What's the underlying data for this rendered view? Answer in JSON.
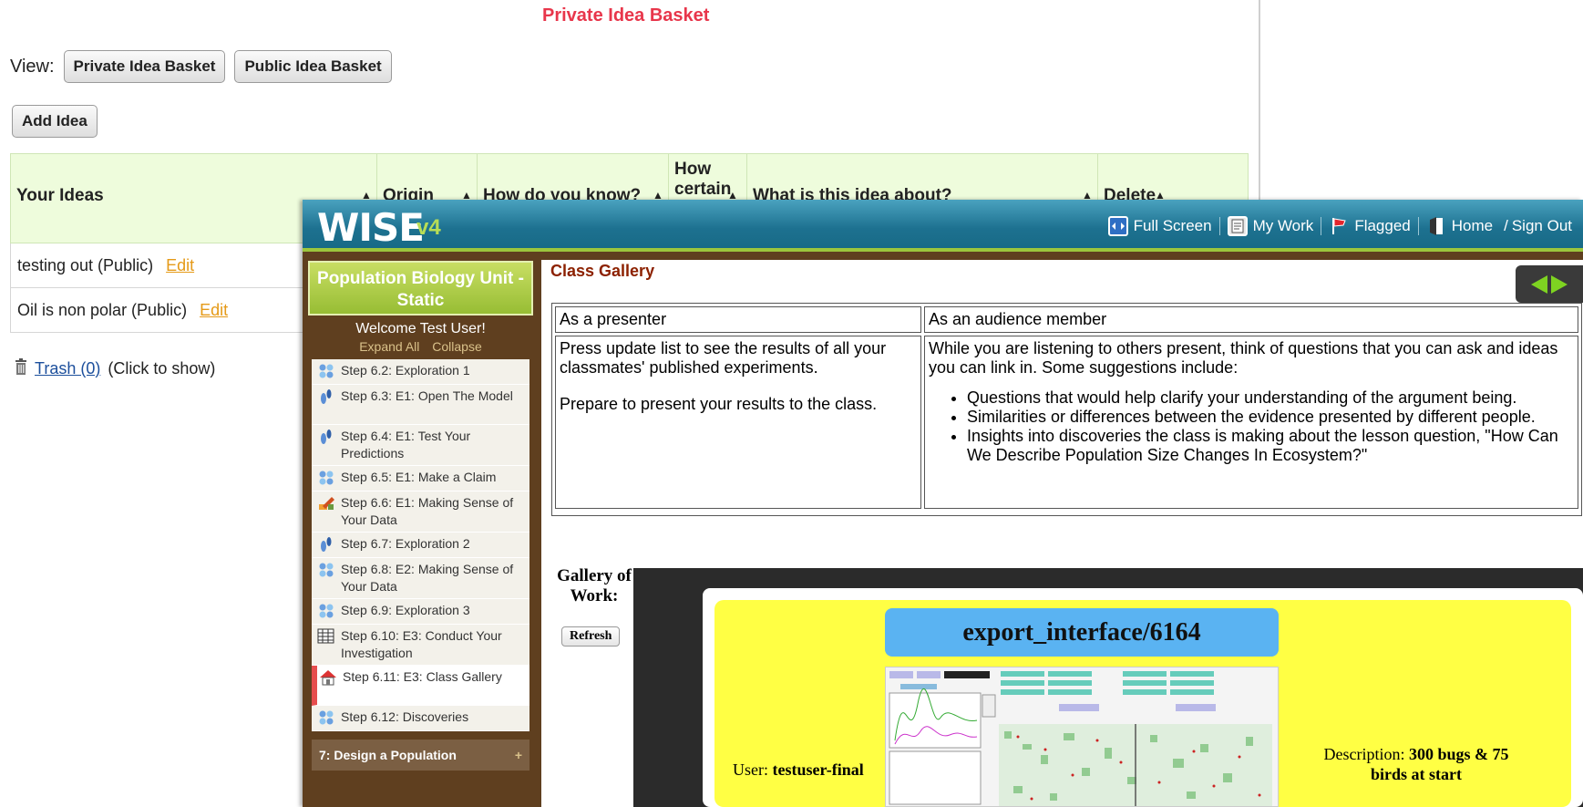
{
  "basket": {
    "title": "Private Idea Basket",
    "view_label": "View:",
    "view_private": "Private Idea Basket",
    "view_public": "Public Idea Basket",
    "add_idea": "Add Idea",
    "columns": [
      "Your Ideas",
      "Origin",
      "How do you know?",
      "How certain",
      "What is this idea about?",
      "Delete"
    ],
    "rows": [
      {
        "idea": "testing out (Public)",
        "edit": "Edit"
      },
      {
        "idea": "Oil is non polar (Public)",
        "edit": "Edit"
      }
    ],
    "trash_link": "Trash (0)",
    "trash_hint": "(Click to show)"
  },
  "wise": {
    "logo": "WISE",
    "version": "v4",
    "nav": {
      "full_screen": "Full Screen",
      "my_work": "My Work",
      "flagged": "Flagged",
      "home": "Home",
      "slash": "/",
      "sign_out": "Sign Out"
    },
    "unit_title": "Population Biology Unit - Static",
    "welcome": "Welcome Test User!",
    "expand_all": "Expand All",
    "collapse": "Collapse",
    "steps": [
      {
        "label": "Step 6.2: Exploration 1",
        "icon": "students-icon"
      },
      {
        "label": "Step 6.3: E1: Open The Model",
        "icon": "footprint-icon"
      },
      {
        "label": "Step 6.4: E1: Test Your Predictions",
        "icon": "footprint-icon"
      },
      {
        "label": "Step 6.5: E1: Make a Claim",
        "icon": "students-icon"
      },
      {
        "label": "Step 6.6: E1: Making Sense of Your Data",
        "icon": "pencil-icon"
      },
      {
        "label": "Step 6.7: Exploration 2",
        "icon": "footprint-icon"
      },
      {
        "label": "Step 6.8: E2: Making Sense of Your Data",
        "icon": "students-icon"
      },
      {
        "label": "Step 6.9: Exploration 3",
        "icon": "students-icon"
      },
      {
        "label": "Step 6.10: E3: Conduct Your Investigation",
        "icon": "grid-icon"
      },
      {
        "label": "Step 6.11: E3: Class Gallery",
        "icon": "house-icon",
        "selected": true
      },
      {
        "label": "Step 6.12: Discoveries",
        "icon": "students-icon"
      }
    ],
    "next_activity": "7: Design a Population",
    "next_activity_toggle": "+",
    "content": {
      "title": "Class Gallery",
      "presenter_head": "As a presenter",
      "audience_head": "As an audience member",
      "presenter_p1": "Press update list to see the results of all your classmates' published experiments.",
      "presenter_p2": "Prepare to present your results to the class.",
      "audience_intro": "While you are listening to others present, think of questions that you can ask and ideas you can link in. Some suggestions include:",
      "audience_bullets": [
        "Questions that would help clarify your understanding of the argument being.",
        "Similarities or differences between the evidence presented by different people.",
        "Insights into discoveries the class is making about the lesson question, \"How Can We Describe Population Size Changes In Ecosystem?\""
      ],
      "gallery_label": "Gallery of Work:",
      "refresh": "Refresh",
      "export_title": "export_interface/6164",
      "user_label": "User:",
      "user_value": "testuser-final",
      "desc_label": "Description:",
      "desc_value": "300 bugs & 75 birds at start"
    }
  },
  "colors": {
    "basket_title": "#e8364b",
    "table_header_bg": "#eefcdc",
    "edit_link": "#e59a18",
    "wise_bar": "#1d7190",
    "wise_accent": "#9cc63d",
    "nav_bg": "#5f3f1f",
    "selected_step_marker": "#e64d4d",
    "gallery_title": "#8c2100",
    "gallery_bg": "#ffff44",
    "export_title_bg": "#5ab3f2"
  }
}
